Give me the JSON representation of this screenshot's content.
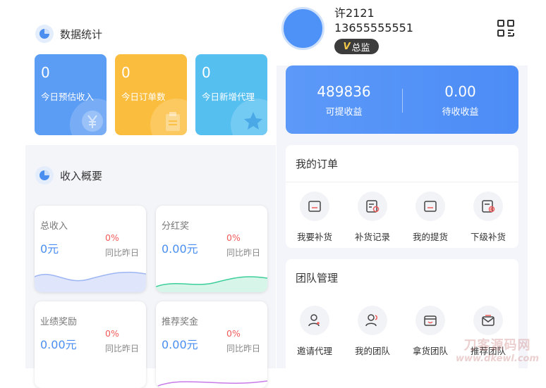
{
  "data_stats": {
    "title": "数据统计",
    "cards": [
      {
        "value": "0",
        "label": "今日预估收入",
        "color": "#5b9cf4"
      },
      {
        "value": "0",
        "label": "今日订单数",
        "color": "#fbbd3e"
      },
      {
        "value": "0",
        "label": "今日新增代理",
        "color": "#55bff0"
      }
    ]
  },
  "income_overview": {
    "title": "收入概要",
    "cards": [
      {
        "title": "总收入",
        "value": "0元",
        "percent": "0%",
        "compare": "同比昨日"
      },
      {
        "title": "分红奖",
        "value": "0.00元",
        "percent": "0%",
        "compare": "同比昨日"
      },
      {
        "title": "业绩奖励",
        "value": "0.00元",
        "percent": "0%",
        "compare": "同比昨日"
      },
      {
        "title": "推荐奖金",
        "value": "0.00元",
        "percent": "0%",
        "compare": "同比昨日"
      }
    ]
  },
  "profile": {
    "name": "许2121",
    "phone": "13655555551",
    "badge_prefix": "V",
    "badge": "总监"
  },
  "earnings": {
    "withdrawable_amount": "489836",
    "withdrawable_label": "可提收益",
    "pending_amount": "0.00",
    "pending_label": "待收收益"
  },
  "my_orders": {
    "title": "我的订单",
    "items": [
      {
        "label": "我要补货",
        "icon": "restock-icon"
      },
      {
        "label": "补货记录",
        "icon": "restock-record-icon"
      },
      {
        "label": "我的提货",
        "icon": "pickup-icon"
      },
      {
        "label": "下级补货",
        "icon": "sub-restock-icon"
      }
    ]
  },
  "team": {
    "title": "团队管理",
    "items": [
      {
        "label": "邀请代理",
        "icon": "invite-agent-icon"
      },
      {
        "label": "我的团队",
        "icon": "my-team-icon"
      },
      {
        "label": "拿货团队",
        "icon": "purchase-team-icon"
      },
      {
        "label": "推荐团队",
        "icon": "recommend-team-icon"
      }
    ]
  },
  "watermark": {
    "line1": "刀客源码网",
    "line2": "www.dkewl.com"
  },
  "colors": {
    "accent": "#4c8cf6",
    "danger": "#f15a5a"
  }
}
